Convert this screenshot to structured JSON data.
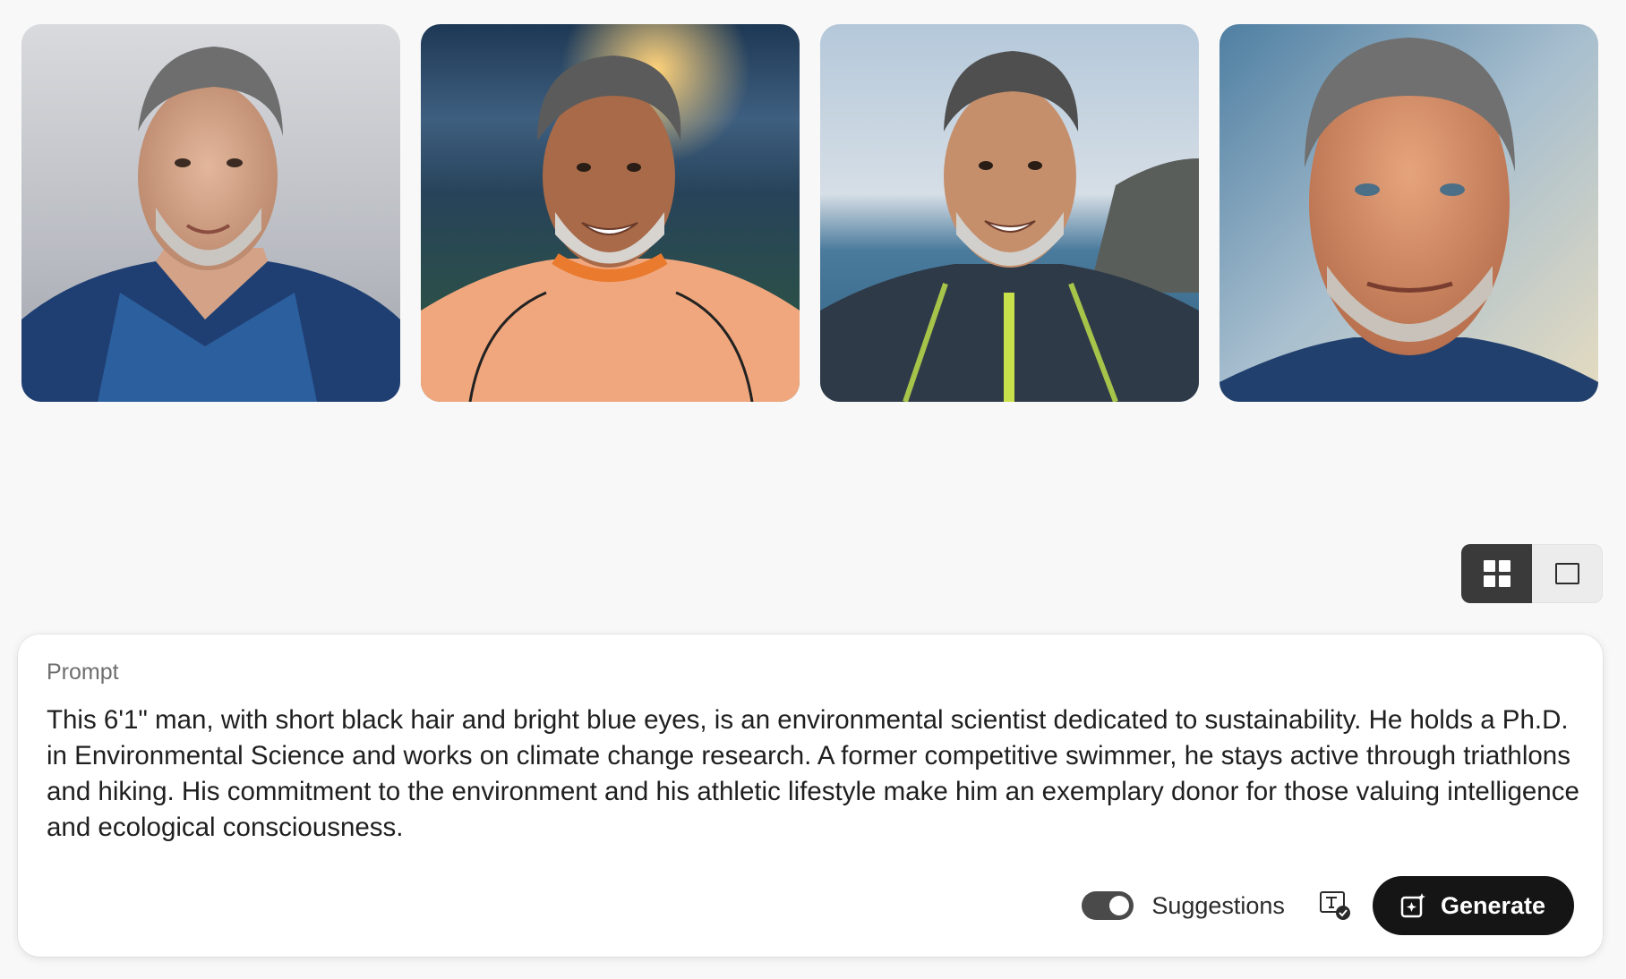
{
  "gallery": {
    "images": [
      {
        "icon": "portrait-image-1"
      },
      {
        "icon": "portrait-image-2"
      },
      {
        "icon": "portrait-image-3"
      },
      {
        "icon": "portrait-image-4"
      }
    ]
  },
  "view_toggle": {
    "active": "grid",
    "options": [
      "grid-view-icon",
      "single-view-icon"
    ]
  },
  "prompt": {
    "label": "Prompt",
    "text": "This 6'1\" man, with short black hair and bright blue eyes, is an environmental scientist dedicated to sustainability. He holds a Ph.D. in Environmental Science and works on climate change research. A former competitive swimmer, he stays active through triathlons and hiking. His commitment to the environment and his athletic lifestyle make him an exemplary donor for those valuing intelligence and ecological consciousness."
  },
  "controls": {
    "suggestions_label": "Suggestions",
    "suggestions_on": true,
    "generate_label": "Generate"
  },
  "colors": {
    "background": "#f8f8f8",
    "panel": "#ffffff",
    "button": "#151515",
    "toggle_active": "#3a3a3a"
  }
}
